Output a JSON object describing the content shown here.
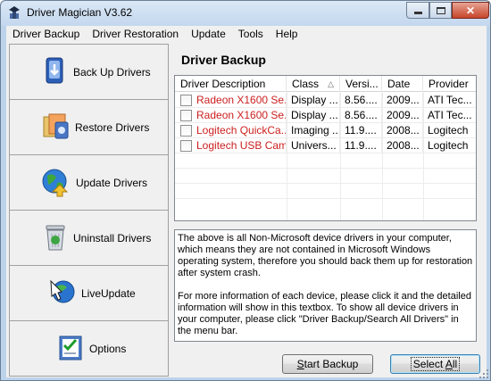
{
  "window": {
    "title": "Driver Magician V3.62",
    "icons": {
      "app": "driver-magician-logo",
      "minimize": "minimize-icon",
      "maximize": "maximize-icon",
      "close": "close-icon"
    }
  },
  "menu": [
    "Driver Backup",
    "Driver Restoration",
    "Update",
    "Tools",
    "Help"
  ],
  "sidebar": {
    "items": [
      {
        "label": "Back Up Drivers",
        "icon": "backup-icon"
      },
      {
        "label": "Restore Drivers",
        "icon": "restore-icon"
      },
      {
        "label": "Update Drivers",
        "icon": "globe-update-icon"
      },
      {
        "label": "Uninstall Drivers",
        "icon": "recycle-bin-icon"
      },
      {
        "label": "LiveUpdate",
        "icon": "live-update-icon"
      },
      {
        "label": "Options",
        "icon": "options-checklist-icon"
      }
    ]
  },
  "main": {
    "heading": "Driver Backup",
    "list": {
      "columns": [
        "Driver Description",
        "Class",
        "Versi...",
        "Date",
        "Provider"
      ],
      "sorted_column": "Class",
      "rows": [
        {
          "description": "Radeon X1600 Se...",
          "class": "Display ...",
          "version": "8.56....",
          "date": "2009...",
          "provider": "ATI Tec...",
          "checked": false
        },
        {
          "description": "Radeon X1600 Se...",
          "class": "Display ...",
          "version": "8.56....",
          "date": "2009...",
          "provider": "ATI Tec...",
          "checked": false
        },
        {
          "description": "Logitech QuickCa...",
          "class": "Imaging ...",
          "version": "11.9....",
          "date": "2008...",
          "provider": "Logitech",
          "checked": false
        },
        {
          "description": "Logitech USB Cam...",
          "class": "Univers...",
          "version": "11.9....",
          "date": "2008...",
          "provider": "Logitech",
          "checked": false
        }
      ],
      "highlight_color": "#cc1e1e"
    },
    "info": {
      "paragraph1": "The above is all Non-Microsoft device drivers in your computer, which means they are not contained in Microsoft Windows operating system, therefore you should back them up for restoration after system crash.",
      "paragraph2": "For more information of each device, please click it and the detailed information will show in this textbox. To show all device drivers in your computer, please click \"Driver Backup/Search All Drivers\" in the menu bar."
    },
    "buttons": {
      "start_backup": {
        "label": "Start Backup",
        "mnemonic": "S",
        "rest": "tart Backup"
      },
      "select_all": {
        "label": "Select All",
        "prefix": "Select ",
        "mnemonic": "A",
        "rest": "ll"
      }
    }
  }
}
